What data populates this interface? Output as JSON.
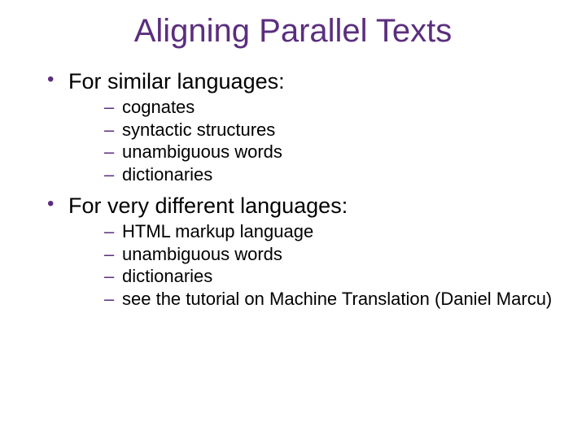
{
  "title": "Aligning Parallel Texts",
  "sections": [
    {
      "heading": "For similar languages:",
      "items": [
        "cognates",
        "syntactic structures",
        "unambiguous words",
        "dictionaries"
      ]
    },
    {
      "heading": "For very different languages:",
      "items": [
        "HTML markup language",
        "unambiguous words",
        "dictionaries",
        "see the tutorial on Machine Translation (Daniel Marcu)"
      ]
    }
  ]
}
